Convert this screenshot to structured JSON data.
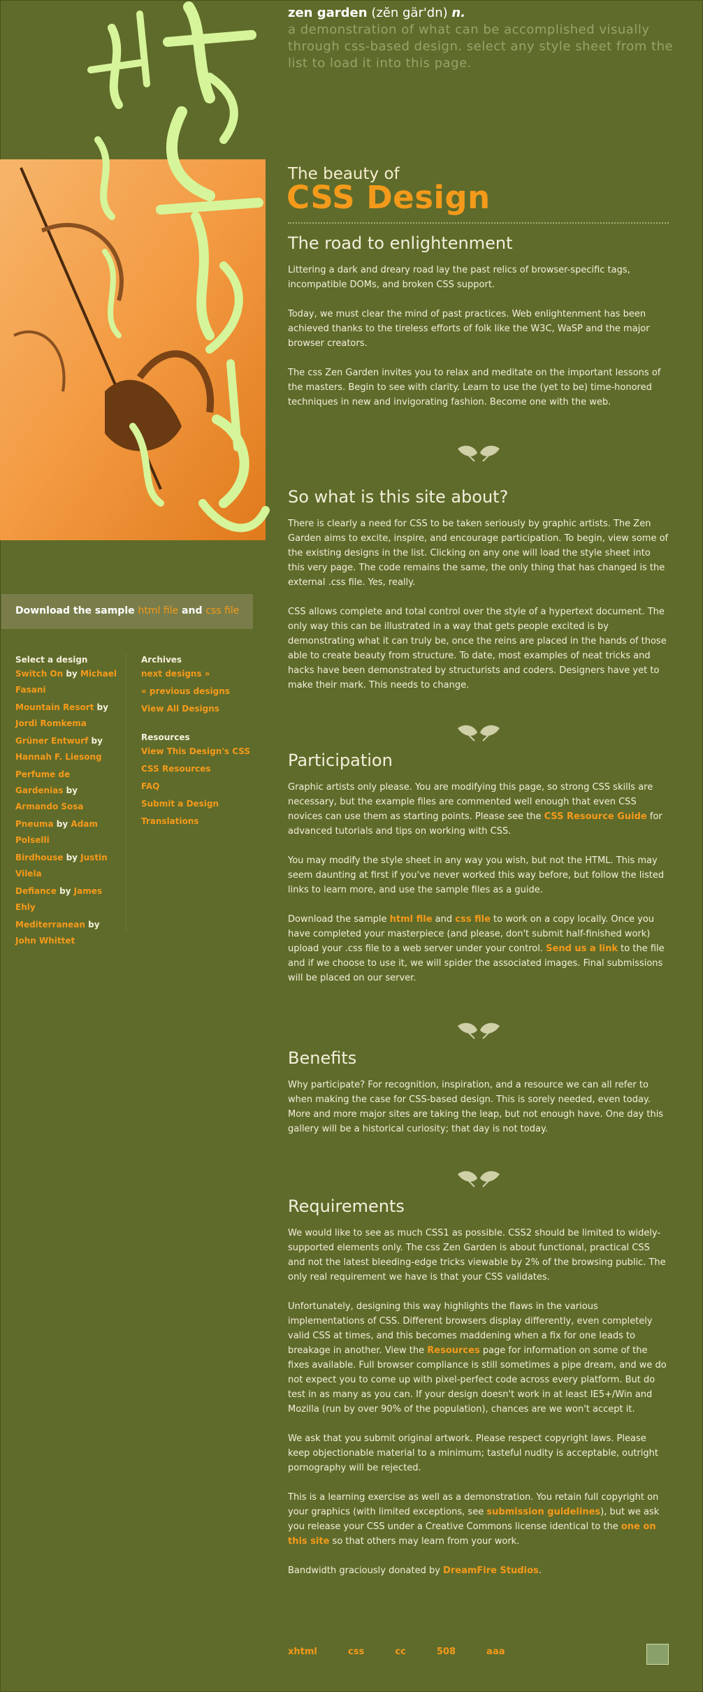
{
  "header": {
    "site_name": "zen garden",
    "pronunciation": " (zĕn gär'dn) ",
    "pos": "n.",
    "tagline": "a demonstration of what can be accomplished visually through css-based design. select any style sheet from the list to load it into this page."
  },
  "intro": {
    "beauty_of": "The beauty of",
    "title": "CSS Design"
  },
  "sections": {
    "road": {
      "heading": "The road to enlightenment",
      "p1": "Littering a dark and dreary road lay the past relics of browser-specific tags, incompatible DOMs, and broken CSS support.",
      "p2": "Today, we must clear the mind of past practices. Web enlightenment has been achieved thanks to the tireless efforts of folk like the W3C, WaSP and the major browser creators.",
      "p3": "The css Zen Garden invites you to relax and meditate on the important lessons of the masters. Begin to see with clarity. Learn to use the (yet to be) time-honored techniques in new and invigorating fashion. Become one with the web."
    },
    "about": {
      "heading": "So what is this site about?",
      "p1": "There is clearly a need for CSS to be taken seriously by graphic artists. The Zen Garden aims to excite, inspire, and encourage participation. To begin, view some of the existing designs in the list. Clicking on any one will load the style sheet into this very page. The code remains the same, the only thing that has changed is the external .css file. Yes, really.",
      "p2": "CSS allows complete and total control over the style of a hypertext document. The only way this can be illustrated in a way that gets people excited is by demonstrating what it can truly be, once the reins are placed in the hands of those able to create beauty from structure. To date, most examples of neat tricks and hacks have been demonstrated by structurists and coders. Designers have yet to make their mark. This needs to change."
    },
    "participation": {
      "heading": "Participation",
      "p1a": "Graphic artists only please. You are modifying this page, so strong CSS skills are necessary, but the example files are commented well enough that even CSS novices can use them as starting points. Please see the ",
      "p1_link": "CSS Resource Guide",
      "p1b": " for advanced tutorials and tips on working with CSS.",
      "p2": "You may modify the style sheet in any way you wish, but not the HTML. This may seem daunting at first if you've never worked this way before, but follow the listed links to learn more, and use the sample files as a guide.",
      "p3a": "Download the sample ",
      "p3_link1": "html file",
      "p3_and": " and ",
      "p3_link2": "css file",
      "p3b": " to work on a copy locally. Once you have completed your masterpiece (and please, don't submit half-finished work) upload your .css file to a web server under your control. ",
      "p3_link3": "Send us a link",
      "p3c": " to the file and if we choose to use it, we will spider the associated images. Final submissions will be placed on our server."
    },
    "benefits": {
      "heading": "Benefits",
      "p1": "Why participate? For recognition, inspiration, and a resource we can all refer to when making the case for CSS-based design. This is sorely needed, even today. More and more major sites are taking the leap, but not enough have. One day this gallery will be a historical curiosity; that day is not today."
    },
    "requirements": {
      "heading": "Requirements",
      "p1": "We would like to see as much CSS1 as possible. CSS2 should be limited to widely-supported elements only. The css Zen Garden is about functional, practical CSS and not the latest bleeding-edge tricks viewable by 2% of the browsing public. The only real requirement we have is that your CSS validates.",
      "p2a": "Unfortunately, designing this way highlights the flaws in the various implementations of CSS. Different browsers display differently, even completely valid CSS at times, and this becomes maddening when a fix for one leads to breakage in another. View the ",
      "p2_link": "Resources",
      "p2b": " page for information on some of the fixes available. Full browser compliance is still sometimes a pipe dream, and we do not expect you to come up with pixel-perfect code across every platform. But do test in as many as you can. If your design doesn't work in at least IE5+/Win and Mozilla (run by over 90% of the population), chances are we won't accept it.",
      "p3": "We ask that you submit original artwork. Please respect copyright laws. Please keep objectionable material to a minimum; tasteful nudity is acceptable, outright pornography will be rejected.",
      "p4a": "This is a learning exercise as well as a demonstration. You retain full copyright on your graphics (with limited exceptions, see ",
      "p4_link1": "submission guidelines",
      "p4b": "), but we ask you release your CSS under a Creative Commons license identical to the ",
      "p4_link2": "one on this site",
      "p4c": " so that others may learn from your work.",
      "p5a": "Bandwidth graciously donated by ",
      "p5_link": "DreamFire Studios",
      "p5b": "."
    }
  },
  "download_bar": {
    "prefix": "Download the sample ",
    "html_link": "html file",
    "and": " and ",
    "css_link": "css file"
  },
  "sidebar": {
    "select_heading": "Select a design",
    "by": " by ",
    "designs": [
      {
        "name": "Switch On",
        "author": "Michael Fasani"
      },
      {
        "name": "Mountain Resort",
        "author": "Jordi Romkema"
      },
      {
        "name": "Grüner Entwurf",
        "author": "Hannah F. Liesong"
      },
      {
        "name": "Perfume de Gardenias",
        "author": "Armando Sosa"
      },
      {
        "name": "Pneuma",
        "author": "Adam Polselli"
      },
      {
        "name": "Birdhouse",
        "author": "Justin Vilela"
      },
      {
        "name": "Defiance",
        "author": "James Ehly"
      },
      {
        "name": "Mediterranean",
        "author": "John Whittet"
      }
    ],
    "archives_heading": "Archives",
    "archives": [
      "next designs »",
      "« previous designs",
      "View All Designs"
    ],
    "resources_heading": "Resources",
    "resources": [
      "View This Design's CSS",
      "CSS Resources",
      "FAQ",
      "Submit a Design",
      "Translations"
    ]
  },
  "footer": {
    "links": [
      "xhtml",
      "css",
      "cc",
      "508",
      "aaa"
    ]
  },
  "colors": {
    "background": "#5f6b2a",
    "accent": "#f49a1b",
    "text": "#f4efdc"
  }
}
